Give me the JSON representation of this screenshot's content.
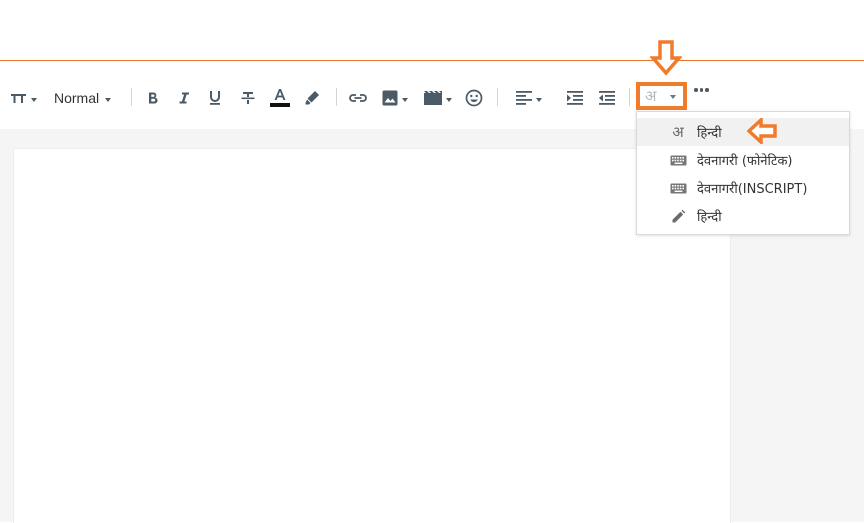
{
  "toolbar": {
    "paragraph_style": "Normal",
    "input_language_glyph": "अ",
    "icons": [
      "text-size-icon",
      "bold-icon",
      "italic-icon",
      "underline-icon",
      "strikethrough-icon",
      "text-color-icon",
      "highlight-icon",
      "link-icon",
      "image-icon",
      "video-icon",
      "emoji-icon",
      "align-icon",
      "indent-icon",
      "outdent-icon",
      "language-icon",
      "more-icon"
    ]
  },
  "language_menu": {
    "items": [
      {
        "icon": "अ",
        "label": "हिन्दी"
      },
      {
        "icon": "keyboard-icon",
        "label": "देवनागरी (फोनेटिक)"
      },
      {
        "icon": "keyboard-icon",
        "label": "देवनागरी(INSCRIPT)"
      },
      {
        "icon": "pencil-icon",
        "label": "हिन्दी"
      }
    ]
  },
  "colors": {
    "accent": "#f07b2b",
    "toolbar_icon": "#4a5a66",
    "workspace_bg": "#f5f5f5"
  }
}
